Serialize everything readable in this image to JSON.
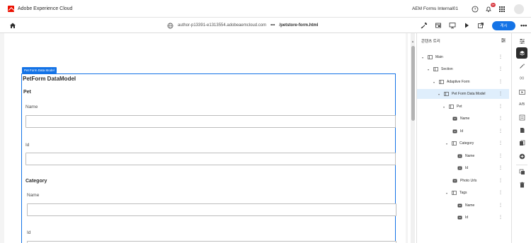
{
  "header": {
    "brand": "Adobe Experience Cloud",
    "org": "AEM Forms Internal01",
    "notification_count": "9+"
  },
  "toolbar": {
    "host": "author-p13391-e1313554.adobeaemcloud.com",
    "dots": "•••",
    "path": "/petstore-form.html",
    "publish_label": "게시",
    "more_label": "•••"
  },
  "canvas": {
    "component_badge": "Pet Form Data Model",
    "form_title": "PetForm DataModel",
    "section_pet": "Pet",
    "label_name": "Name",
    "label_id": "Id",
    "section_category": "Category",
    "label_cat_name": "Name",
    "label_cat_id": "Id"
  },
  "panel": {
    "title": "콘텐츠 트리",
    "tree": [
      {
        "label": "Main"
      },
      {
        "label": "Section"
      },
      {
        "label": "Adaptive Form"
      },
      {
        "label": "Pet Form Data Model"
      },
      {
        "label": "Pet"
      },
      {
        "label": "Name"
      },
      {
        "label": "Id"
      },
      {
        "label": "Category"
      },
      {
        "label": "Name"
      },
      {
        "label": "Id"
      },
      {
        "label": "Photo Urls"
      },
      {
        "label": "Tags"
      },
      {
        "label": "Name"
      },
      {
        "label": "Id"
      }
    ]
  },
  "rail": {
    "ab_label": "A/B",
    "fx_label": "(x)"
  },
  "colors": {
    "accent": "#1473e6",
    "brand": "#eb1000",
    "selected_row": "#dfeefc"
  }
}
